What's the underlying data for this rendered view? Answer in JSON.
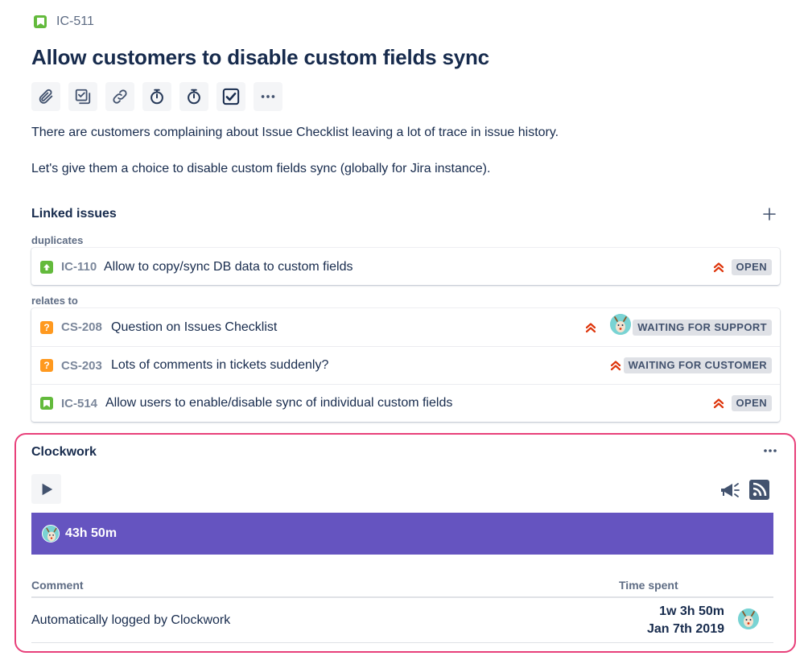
{
  "issue": {
    "key": "IC-511",
    "title": "Allow customers to disable custom fields sync",
    "type_icon": "story-icon"
  },
  "toolbar": {
    "buttons": [
      "attach-icon",
      "checklist-icon",
      "link-icon",
      "stopwatch-icon",
      "stopwatch-icon",
      "checkbox-icon",
      "more-icon"
    ]
  },
  "description": {
    "paragraphs": [
      "There are customers complaining about Issue Checklist leaving a lot of trace in issue history.",
      "Let's give them a choice to disable custom fields sync (globally for Jira instance)."
    ]
  },
  "linked_issues": {
    "title": "Linked issues",
    "groups": [
      {
        "relation": "duplicates",
        "items": [
          {
            "key": "IC-110",
            "summary": "Allow to copy/sync DB data to custom fields",
            "status": "OPEN",
            "priority": "highest",
            "type": "improvement"
          }
        ]
      },
      {
        "relation": "relates to",
        "items": [
          {
            "key": "CS-208",
            "summary": "Question on Issues Checklist",
            "status": "WAITING FOR SUPPORT",
            "priority": "highest",
            "type": "question",
            "has_avatar": true
          },
          {
            "key": "CS-203",
            "summary": "Lots of comments in tickets suddenly?",
            "status": "WAITING FOR CUSTOMER",
            "priority": "highest",
            "type": "question"
          },
          {
            "key": "IC-514",
            "summary": "Allow users to enable/disable sync of individual custom fields",
            "status": "OPEN",
            "priority": "highest",
            "type": "story"
          }
        ]
      }
    ]
  },
  "clockwork": {
    "title": "Clockwork",
    "total": "43h 50m",
    "bar_color": "#6554c0",
    "columns": {
      "comment": "Comment",
      "time_spent": "Time spent"
    },
    "worklogs": [
      {
        "comment": "Automatically logged by Clockwork",
        "duration": "1w 3h 50m",
        "date": "Jan 7th 2019"
      }
    ]
  },
  "colors": {
    "highlight_border": "#e8407a",
    "priority_red": "#de350b",
    "status_badge_bg": "#dfe1e6"
  }
}
